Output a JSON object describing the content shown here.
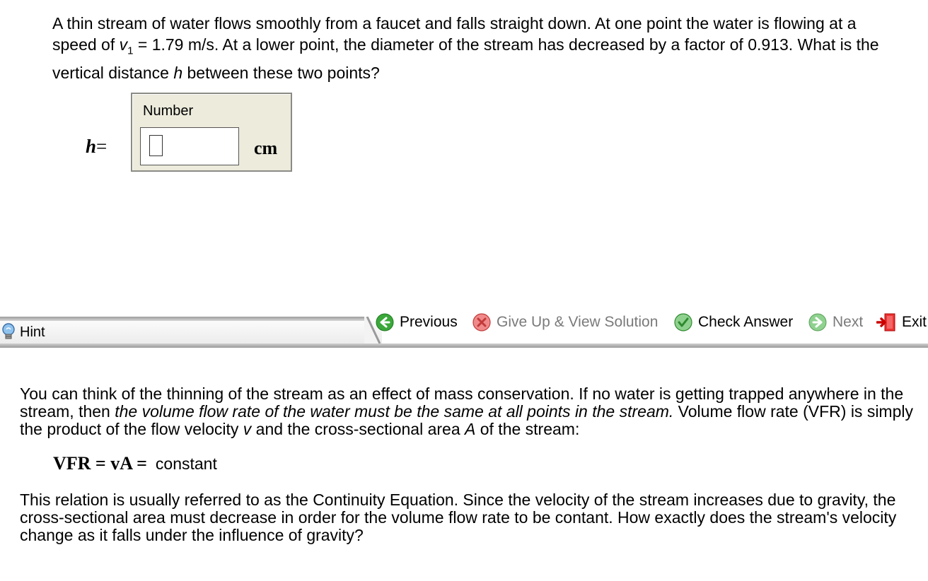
{
  "question": {
    "p1": "A thin stream of water flows smoothly from a faucet and falls straight down. At one point the water is flowing at a speed of ",
    "v_symbol": "v",
    "v_subscript": "1",
    "p2": " = 1.79 m/s. At a lower point, the diameter of the stream has decreased by a factor of 0.913. What is the vertical distance ",
    "h_symbol": "h",
    "p3": " between these two points?"
  },
  "answer": {
    "variable": "h",
    "equals": "=",
    "field_label": "Number",
    "value": "",
    "unit": "cm"
  },
  "toolbar": {
    "hint_label": "Hint",
    "previous_label": "Previous",
    "give_up_label": "Give Up & View Solution",
    "check_label": "Check Answer",
    "next_label": "Next",
    "exit_label": "Exit"
  },
  "hint_text": {
    "p1": "You can think of the thinning of the stream as an effect of mass conservation. If no water is getting trapped anywhere in the stream, then ",
    "p1_italic": "the volume flow rate of the water must be the same at all points in the stream.",
    "p2": " Volume flow rate (VFR) is simply the product of the flow velocity ",
    "v": "v",
    "p3": " and the cross-sectional area ",
    "A": "A",
    "p4": " of the stream:",
    "formula_math": "VFR = vA =",
    "formula_text": "constant",
    "p5": "This relation is usually referred to as the Continuity Equation. Since the velocity of the stream increases due to gravity, the cross-sectional area must decrease in order for the volume flow rate to be contant. How exactly does the stream's velocity change as it falls under the influence of gravity?"
  },
  "colors": {
    "panel_bg": "#ecebdc",
    "nav_green": "#3aa83a",
    "give_up_red": "#d93b3b",
    "disabled_text": "#7a7a7a"
  }
}
